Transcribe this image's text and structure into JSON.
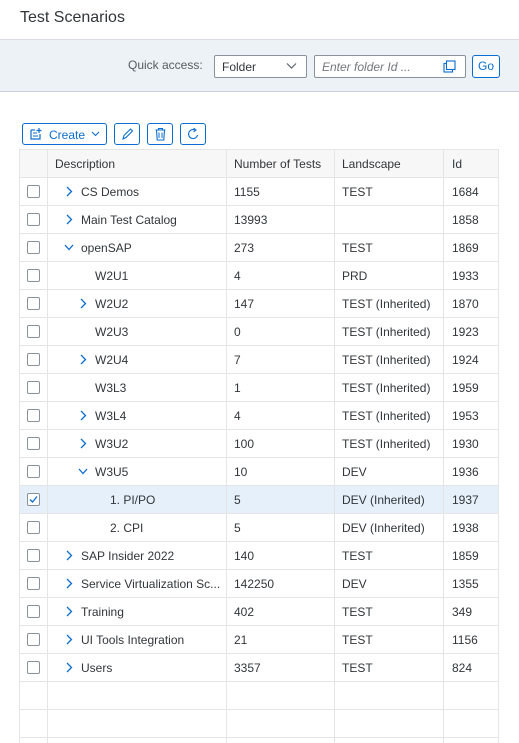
{
  "page": {
    "title": "Test Scenarios"
  },
  "quick_access": {
    "label": "Quick access:",
    "selected": "Folder",
    "placeholder": "Enter folder Id ...",
    "go_label": "Go"
  },
  "toolbar": {
    "create_label": "Create"
  },
  "table": {
    "headers": {
      "description": "Description",
      "tests": "Number of Tests",
      "landscape": "Landscape",
      "id": "Id"
    },
    "rows": [
      {
        "description": "CS Demos",
        "tests": "1155",
        "landscape": "TEST",
        "id": "1684",
        "expander": "collapsed",
        "checked": false
      },
      {
        "description": "Main Test Catalog",
        "tests": "13993",
        "landscape": "",
        "id": "1858",
        "expander": "collapsed",
        "checked": false
      },
      {
        "description": "openSAP",
        "tests": "273",
        "landscape": "TEST",
        "id": "1869",
        "expander": "expanded",
        "checked": false
      },
      {
        "description": "W2U1",
        "tests": "4",
        "landscape": "PRD",
        "id": "1933",
        "expander": "none",
        "checked": false
      },
      {
        "description": "W2U2",
        "tests": "147",
        "landscape": "TEST (Inherited)",
        "id": "1870",
        "expander": "collapsed",
        "checked": false
      },
      {
        "description": "W2U3",
        "tests": "0",
        "landscape": "TEST (Inherited)",
        "id": "1923",
        "expander": "none",
        "checked": false
      },
      {
        "description": "W2U4",
        "tests": "7",
        "landscape": "TEST (Inherited)",
        "id": "1924",
        "expander": "collapsed",
        "checked": false
      },
      {
        "description": "W3L3",
        "tests": "1",
        "landscape": "TEST (Inherited)",
        "id": "1959",
        "expander": "none",
        "checked": false
      },
      {
        "description": "W3L4",
        "tests": "4",
        "landscape": "TEST (Inherited)",
        "id": "1953",
        "expander": "collapsed",
        "checked": false
      },
      {
        "description": "W3U2",
        "tests": "100",
        "landscape": "TEST (Inherited)",
        "id": "1930",
        "expander": "collapsed",
        "checked": false
      },
      {
        "description": "W3U5",
        "tests": "10",
        "landscape": "DEV",
        "id": "1936",
        "expander": "expanded",
        "checked": false
      },
      {
        "description": "1. PI/PO",
        "tests": "5",
        "landscape": "DEV (Inherited)",
        "id": "1937",
        "expander": "none",
        "checked": true
      },
      {
        "description": "2. CPI",
        "tests": "5",
        "landscape": "DEV (Inherited)",
        "id": "1938",
        "expander": "none",
        "checked": false
      },
      {
        "description": "SAP Insider 2022",
        "tests": "140",
        "landscape": "TEST",
        "id": "1859",
        "expander": "collapsed",
        "checked": false
      },
      {
        "description": "Service Virtualization Sc...",
        "tests": "142250",
        "landscape": "DEV",
        "id": "1355",
        "expander": "collapsed",
        "checked": false
      },
      {
        "description": "Training",
        "tests": "402",
        "landscape": "TEST",
        "id": "349",
        "expander": "collapsed",
        "checked": false
      },
      {
        "description": "UI Tools Integration",
        "tests": "21",
        "landscape": "TEST",
        "id": "1156",
        "expander": "collapsed",
        "checked": false
      },
      {
        "description": "Users",
        "tests": "3357",
        "landscape": "TEST",
        "id": "824",
        "expander": "collapsed",
        "checked": false
      }
    ]
  },
  "colors": {
    "accent": "#0a6ed1",
    "selected_row": "#e5f0fa",
    "filter_bar": "#edf2f7"
  }
}
